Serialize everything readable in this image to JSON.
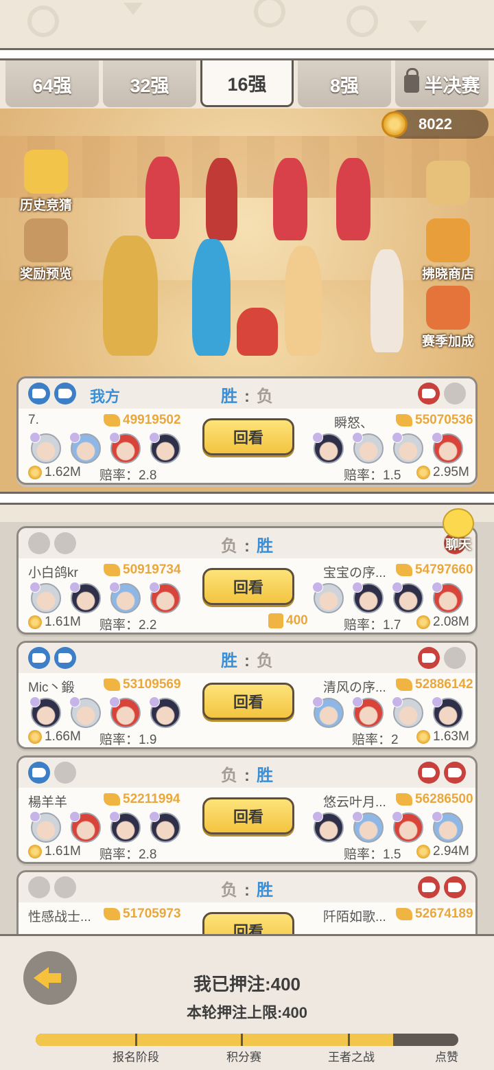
{
  "tabs": [
    {
      "label": "64强",
      "active": false,
      "locked": false
    },
    {
      "label": "32强",
      "active": false,
      "locked": false
    },
    {
      "label": "16强",
      "active": true,
      "locked": false
    },
    {
      "label": "8强",
      "active": false,
      "locked": false
    },
    {
      "label": "半决赛",
      "active": false,
      "locked": true
    }
  ],
  "currency": {
    "amount": "8022"
  },
  "side_left": [
    {
      "label": "历史竞猜"
    },
    {
      "label": "奖励预览"
    }
  ],
  "side_right": [
    {
      "label": "拂晓商店"
    },
    {
      "label": "赛季加成"
    }
  ],
  "my_match": {
    "team_label": "我方",
    "left_result": "胜",
    "right_result": "负",
    "left": {
      "name": "7.",
      "power": "49919502",
      "bet": "1.62M",
      "odds": "赔率：2.8"
    },
    "right": {
      "name": "瞬怒、",
      "power": "55070536",
      "bet": "2.95M",
      "odds": "赔率：1.5"
    },
    "replay": "回看"
  },
  "chat_label": "聊天",
  "matches": [
    {
      "left_result": "负",
      "right_result": "胜",
      "left": {
        "name": "小白鸽kr",
        "power": "50919734",
        "bet": "1.61M",
        "odds": "赔率：2.2"
      },
      "right": {
        "name": "宝宝の序...",
        "power": "54797660",
        "bet": "2.08M",
        "odds": "赔率：1.7"
      },
      "replay": "回看",
      "likes": "400"
    },
    {
      "left_result": "胜",
      "right_result": "负",
      "left": {
        "name": "Mic丶鍛",
        "power": "53109569",
        "bet": "1.66M",
        "odds": "赔率：1.9"
      },
      "right": {
        "name": "清风の序...",
        "power": "52886142",
        "bet": "1.63M",
        "odds": "赔率：2"
      },
      "replay": "回看"
    },
    {
      "left_result": "负",
      "right_result": "胜",
      "left": {
        "name": "楊羊羊",
        "power": "52211994",
        "bet": "1.61M",
        "odds": "赔率：2.8"
      },
      "right": {
        "name": "悠云叶月...",
        "power": "56286500",
        "bet": "2.94M",
        "odds": "赔率：1.5"
      },
      "replay": "回看"
    },
    {
      "left_result": "负",
      "right_result": "胜",
      "left": {
        "name": "性感战士...",
        "power": "51705973"
      },
      "right": {
        "name": "阡陌如歌...",
        "power": "52674189"
      },
      "replay": "回看"
    }
  ],
  "footer": {
    "my_bet": "我已押注:400",
    "limit": "本轮押注上限:400",
    "progress_fraction": 0.85,
    "stages": [
      "报名阶段",
      "积分赛",
      "王者之战",
      "点赞"
    ]
  }
}
